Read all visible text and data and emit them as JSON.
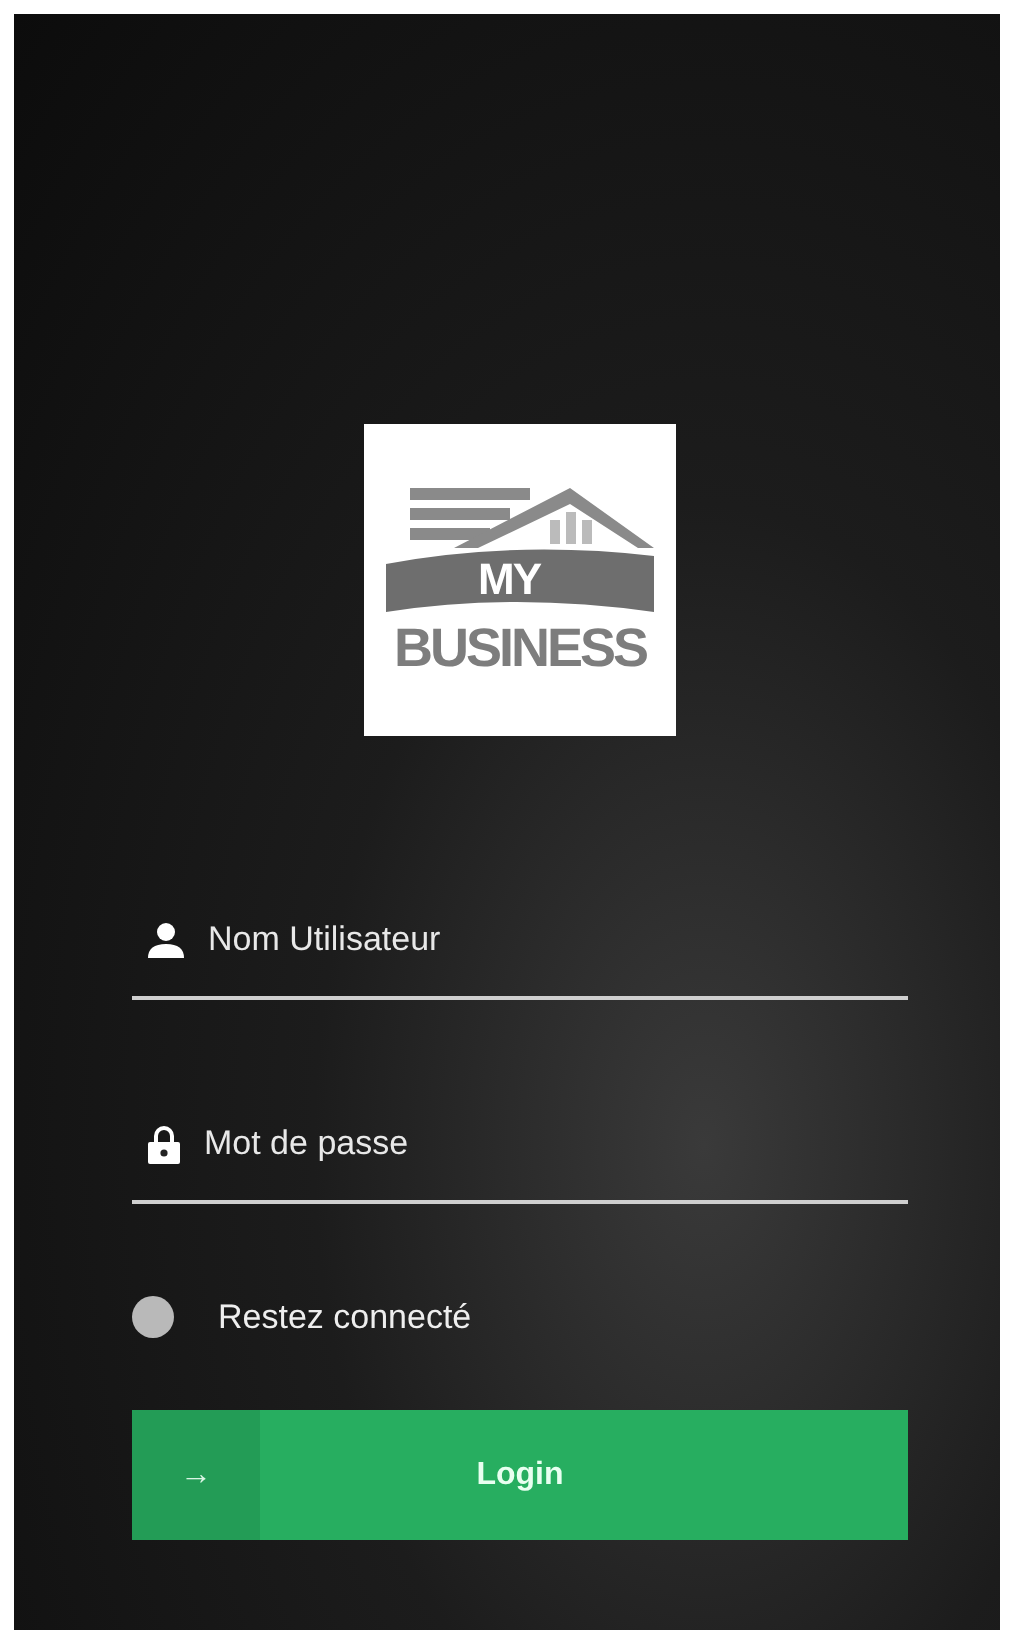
{
  "logo": {
    "line_1": "MY",
    "line_2": "BUSINESS"
  },
  "username": {
    "placeholder": "Nom Utilisateur"
  },
  "password": {
    "placeholder": "Mot de passe"
  },
  "remember": {
    "label": "Restez connecté",
    "checked": false
  },
  "login_button": {
    "icon": "→",
    "label": "Login"
  }
}
